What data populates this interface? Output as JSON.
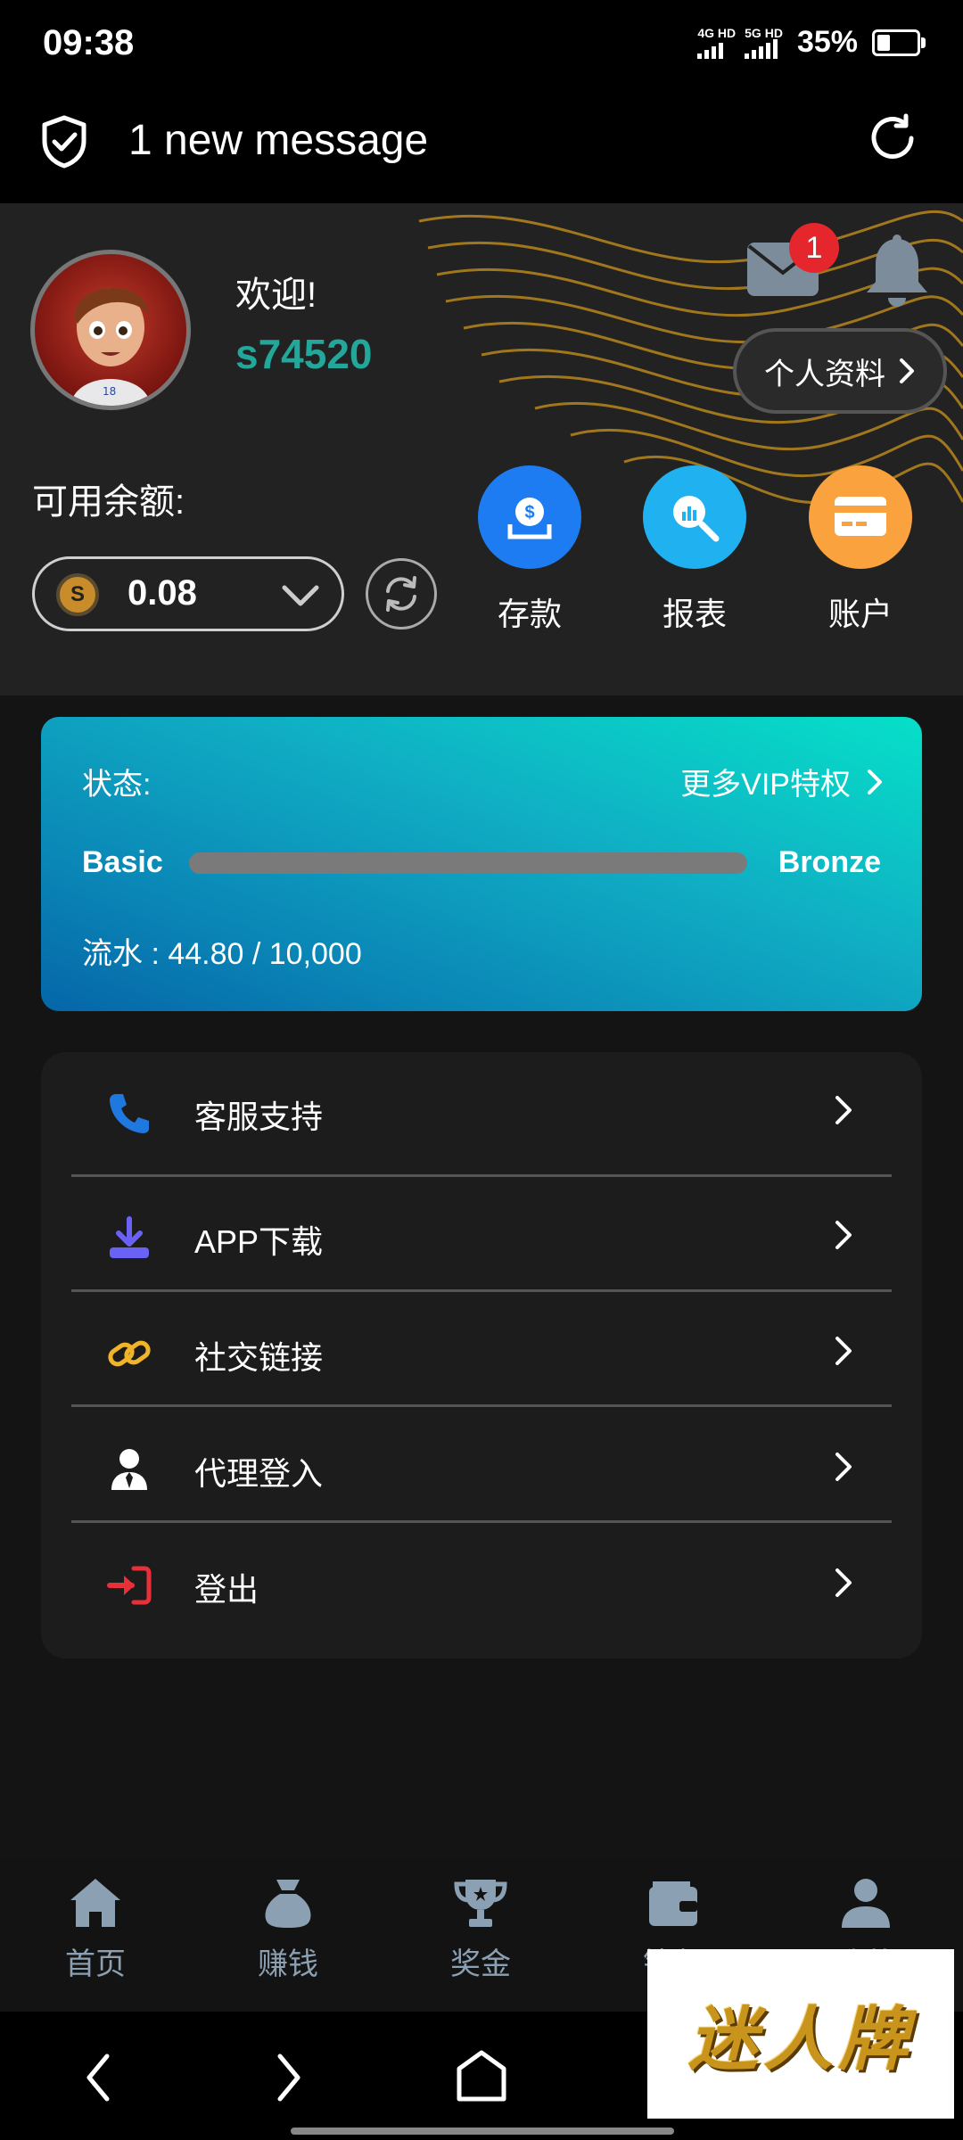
{
  "status_bar": {
    "time": "09:38",
    "net1": "4G HD",
    "net2": "5G HD",
    "battery": "35%"
  },
  "message_bar": {
    "text": "1 new message"
  },
  "profile": {
    "welcome": "欢迎!",
    "username": "s74520",
    "mail_badge": "1",
    "profile_button": "个人资料",
    "balance_label": "可用余额:",
    "coin_symbol": "S",
    "balance": "0.08",
    "actions": [
      {
        "label": "存款",
        "icon": "deposit-icon",
        "color": "#1e7cf2"
      },
      {
        "label": "报表",
        "icon": "report-icon",
        "color": "#1fb1f0"
      },
      {
        "label": "账户",
        "icon": "card-icon",
        "color": "#f9a23e"
      }
    ]
  },
  "vip": {
    "status_label": "状态:",
    "more_label": "更多VIP特权",
    "current_level": "Basic",
    "next_level": "Bronze",
    "turnover": "流水 : 44.80 / 10,000"
  },
  "menu": {
    "items": [
      {
        "label": "客服支持",
        "icon": "phone-icon",
        "color": "#1f78e0"
      },
      {
        "label": "APP下载",
        "icon": "download-icon",
        "color": "#6a62f5"
      },
      {
        "label": "社交链接",
        "icon": "link-icon",
        "color": "#f0b428"
      },
      {
        "label": "代理登入",
        "icon": "agent-icon",
        "color": "#ffffff"
      },
      {
        "label": "登出",
        "icon": "logout-icon",
        "color": "#e8303a"
      }
    ]
  },
  "bottom_nav": {
    "items": [
      {
        "label": "首页",
        "icon": "home-icon"
      },
      {
        "label": "赚钱",
        "icon": "money-bag-icon"
      },
      {
        "label": "奖金",
        "icon": "trophy-icon"
      },
      {
        "label": "钱包",
        "icon": "wallet-icon"
      },
      {
        "label": "我的",
        "icon": "user-icon"
      }
    ]
  },
  "watermark": {
    "text": "迷人牌"
  }
}
